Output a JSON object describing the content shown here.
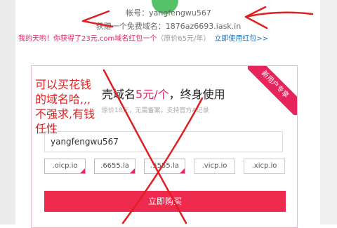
{
  "account": {
    "label": "帐号：yangfengwu567"
  },
  "free_domain": {
    "label": "获赠一个免费域名：1876az6693.iask.in"
  },
  "promo": {
    "text": "我的天哟！你获得了23元.com域名红包一个",
    "original_price": "（原价65元/年）",
    "link": "立即使用红包>>"
  },
  "card": {
    "ribbon": "新用户专享",
    "headline_prefix": "壳域名",
    "headline_price": "5元/个",
    "headline_suffix": "，终身使用",
    "subline": "原价18元，无需备案，支持官方A记录",
    "input_value": "yangfengwu567",
    "suffixes": [
      {
        "label": ".oicp.io",
        "selected": true
      },
      {
        "label": ".6655.la",
        "selected": true
      },
      {
        "label": ".5555.la",
        "selected": true
      },
      {
        "label": ".vicp.io",
        "selected": false
      },
      {
        "label": ".xicp.io",
        "selected": false
      }
    ],
    "buy_button": "立即购买"
  },
  "annotation": {
    "note_lines": [
      "可以买花钱",
      "的域名哈,,,",
      "不强求,有钱",
      "任性"
    ],
    "color": "#e02020"
  },
  "colors": {
    "accent": "#e0245e",
    "button": "#ee2a4e",
    "link": "#1a73c8",
    "avatar": "#55c267"
  }
}
